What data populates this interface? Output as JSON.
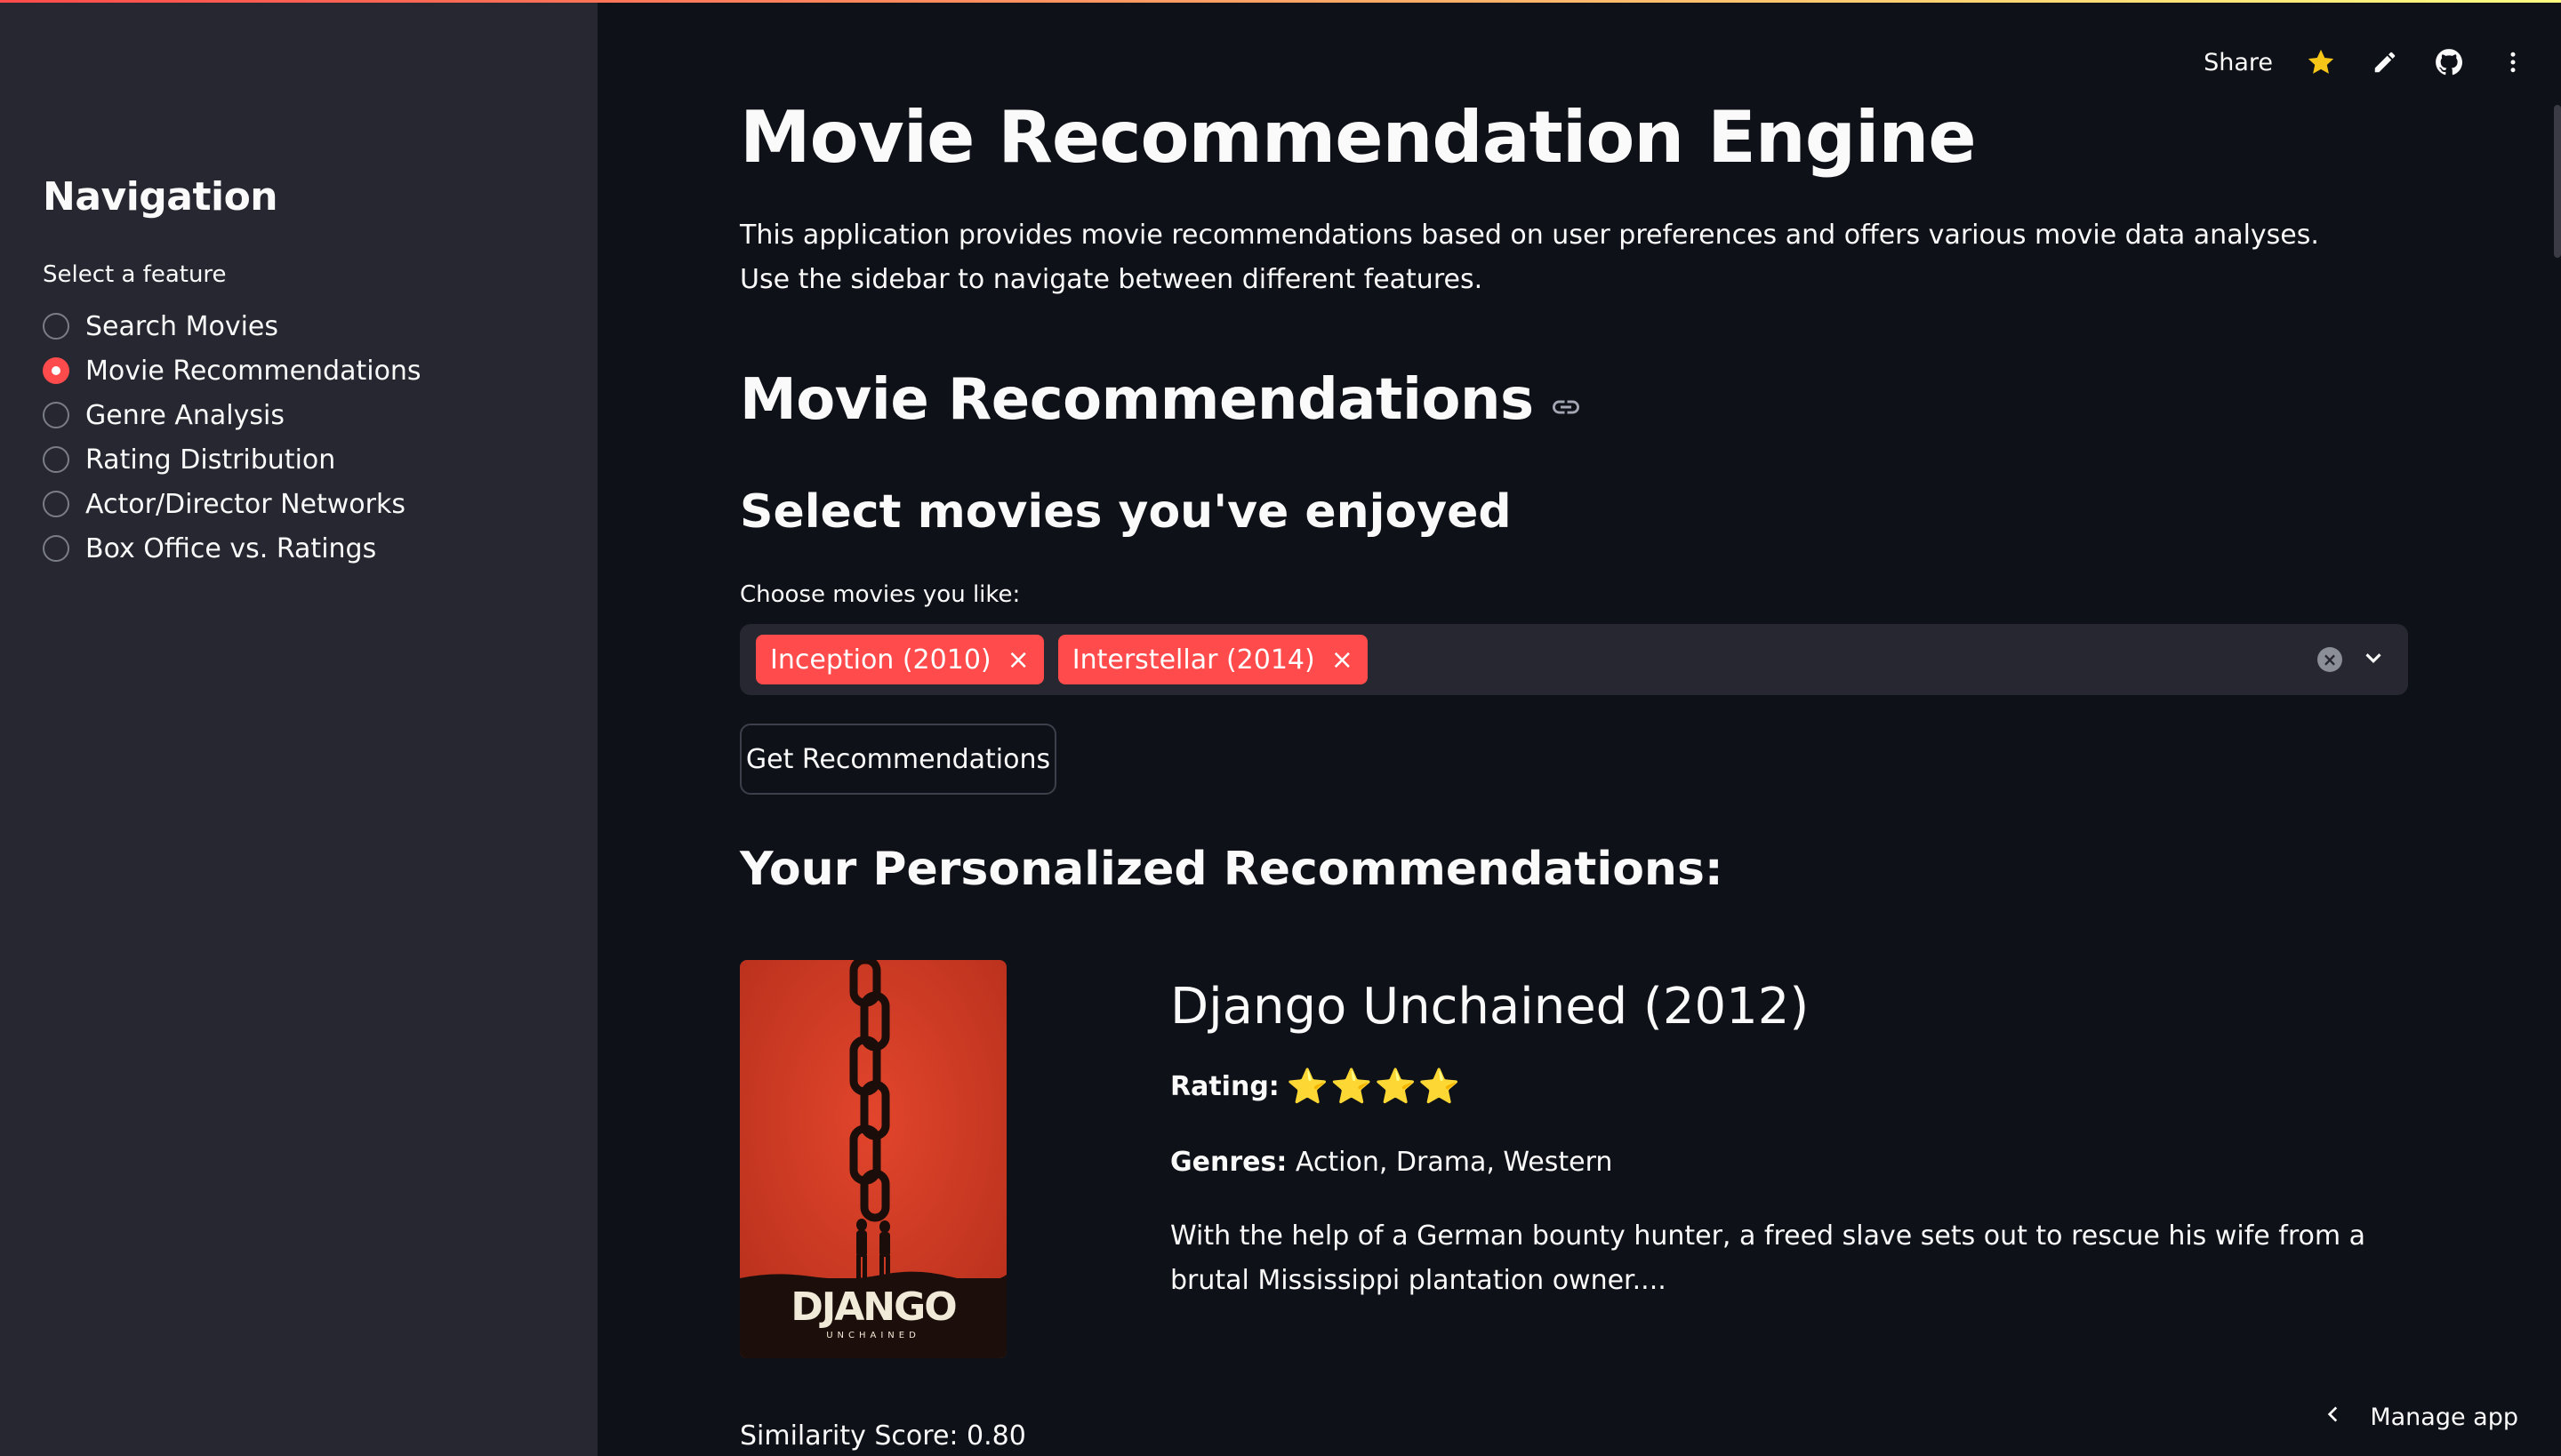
{
  "header": {
    "share_label": "Share",
    "icons": [
      "star-icon",
      "pencil-icon",
      "github-icon",
      "more-vert-icon"
    ],
    "accent": "#ff4b4b"
  },
  "sidebar": {
    "title": "Navigation",
    "select_label": "Select a feature",
    "options": [
      {
        "label": "Search Movies",
        "selected": false
      },
      {
        "label": "Movie Recommendations",
        "selected": true
      },
      {
        "label": "Genre Analysis",
        "selected": false
      },
      {
        "label": "Rating Distribution",
        "selected": false
      },
      {
        "label": "Actor/Director Networks",
        "selected": false
      },
      {
        "label": "Box Office vs. Ratings",
        "selected": false
      }
    ]
  },
  "main": {
    "title": "Movie Recommendation Engine",
    "intro": "This application provides movie recommendations based on user preferences and offers various movie data analyses. Use the sidebar to navigate between different features.",
    "section_title": "Movie Recommendations",
    "subsection_title": "Select movies you've enjoyed",
    "multiselect": {
      "label": "Choose movies you like:",
      "selected": [
        "Inception (2010)",
        "Interstellar (2014)"
      ]
    },
    "button_label": "Get Recommendations",
    "results_title": "Your Personalized Recommendations:",
    "recommendation": {
      "title": "Django Unchained (2012)",
      "rating_label": "Rating:",
      "rating_stars": "⭐⭐⭐⭐",
      "rating_value": 4,
      "genres_label": "Genres:",
      "genres": "Action, Drama, Western",
      "overview": "With the help of a German bounty hunter, a freed slave sets out to rescue his wife from a brutal Mississippi plantation owner....",
      "poster_text": "DJANGO",
      "poster_subtext": "UNCHAINED",
      "similarity": "Similarity Score: 0.80"
    }
  },
  "footer": {
    "manage_app": "Manage app"
  }
}
